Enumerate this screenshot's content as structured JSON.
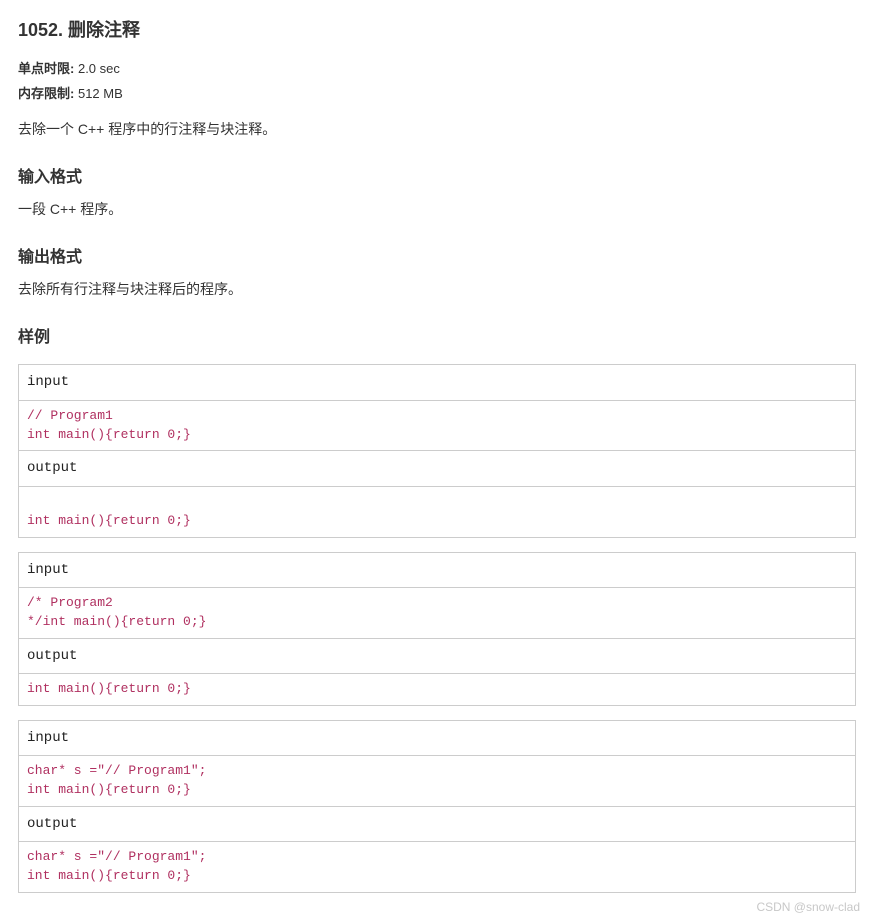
{
  "title": "1052. 删除注释",
  "meta": {
    "time_label": "单点时限:",
    "time_value": "2.0 sec",
    "mem_label": "内存限制:",
    "mem_value": "512 MB"
  },
  "description": "去除一个 C++ 程序中的行注释与块注释。",
  "sections": {
    "input_format": {
      "heading": "输入格式",
      "body": "一段 C++ 程序。"
    },
    "output_format": {
      "heading": "输出格式",
      "body": "去除所有行注释与块注释后的程序。"
    },
    "examples_heading": "样例"
  },
  "labels": {
    "input": "input",
    "output": "output"
  },
  "examples": [
    {
      "input": "// Program1\nint main(){return 0;}",
      "output": "\nint main(){return 0;}"
    },
    {
      "input": "/* Program2\n*/int main(){return 0;}",
      "output": "int main(){return 0;}"
    },
    {
      "input": "char* s =\"// Program1\";\nint main(){return 0;}",
      "output": "char* s =\"// Program1\";\nint main(){return 0;}"
    }
  ],
  "watermark": "CSDN @snow-clad"
}
